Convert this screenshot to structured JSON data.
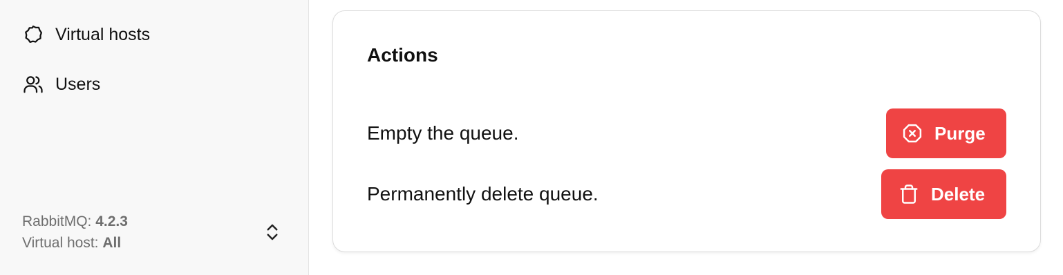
{
  "sidebar": {
    "items": [
      {
        "label": "Virtual hosts",
        "icon": "octagon-icon"
      },
      {
        "label": "Users",
        "icon": "users-icon"
      }
    ],
    "footer": {
      "version_label": "RabbitMQ:",
      "version_value": "4.2.3",
      "vhost_label": "Virtual host:",
      "vhost_value": "All",
      "toggle_icon": "chevrons-up-down-icon"
    }
  },
  "actions": {
    "title": "Actions",
    "purge": {
      "description": "Empty the queue.",
      "button_label": "Purge",
      "icon": "circle-x-icon"
    },
    "delete": {
      "description": "Permanently delete queue.",
      "button_label": "Delete",
      "icon": "trash-icon"
    }
  },
  "colors": {
    "danger": "#ef4444",
    "sidebar_bg": "#f8f8f8",
    "muted_text": "#6e6e6e"
  }
}
